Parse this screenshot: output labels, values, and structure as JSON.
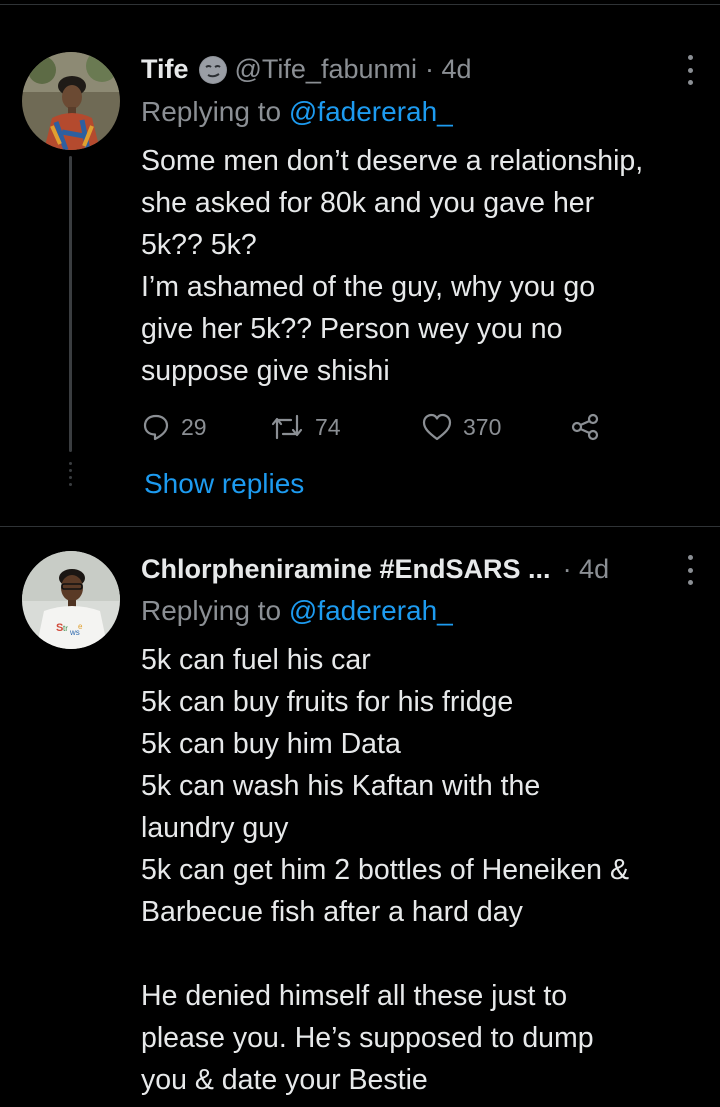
{
  "tweets": [
    {
      "name": "Tife",
      "handle": "@Tife_fabunmi",
      "time": "· 4d",
      "replying_prefix": "Replying to ",
      "replying_to": "@fadererah_",
      "lines": [
        "Some men don’t deserve a relationship,",
        "she asked for 80k and you gave her",
        "5k?? 5k?",
        "I’m ashamed of the guy, why you go",
        "give her 5k?? Person wey you no",
        "suppose give shishi"
      ],
      "stats": {
        "replies": "29",
        "retweets": "74",
        "likes": "370"
      },
      "show_replies": "Show replies",
      "avatar_icon": "avatar-photo",
      "badge_icon": "smirk-emoji-icon"
    },
    {
      "name": "Chlorpheniramine #EndSARS ...",
      "time": "· 4d",
      "replying_prefix": "Replying to ",
      "replying_to": "@fadererah_",
      "lines": [
        "5k can fuel his car",
        "5k can buy fruits for his fridge",
        "5k can buy him Data",
        "5k can wash his Kaftan with the",
        "laundry guy",
        "5k can get him 2 bottles of Heneiken &",
        "Barbecue fish after a hard day",
        "",
        "He denied himself all these just to",
        "please you. He’s supposed to dump",
        "you & date your Bestie"
      ],
      "avatar_icon": "avatar-photo"
    }
  ],
  "colors": {
    "background": "#000000",
    "text": "#e7e9ea",
    "muted": "#8b8f94",
    "accent": "#1d9bf0"
  },
  "icons": [
    "more-options-icon",
    "reply-icon",
    "retweet-icon",
    "like-icon",
    "share-icon"
  ]
}
